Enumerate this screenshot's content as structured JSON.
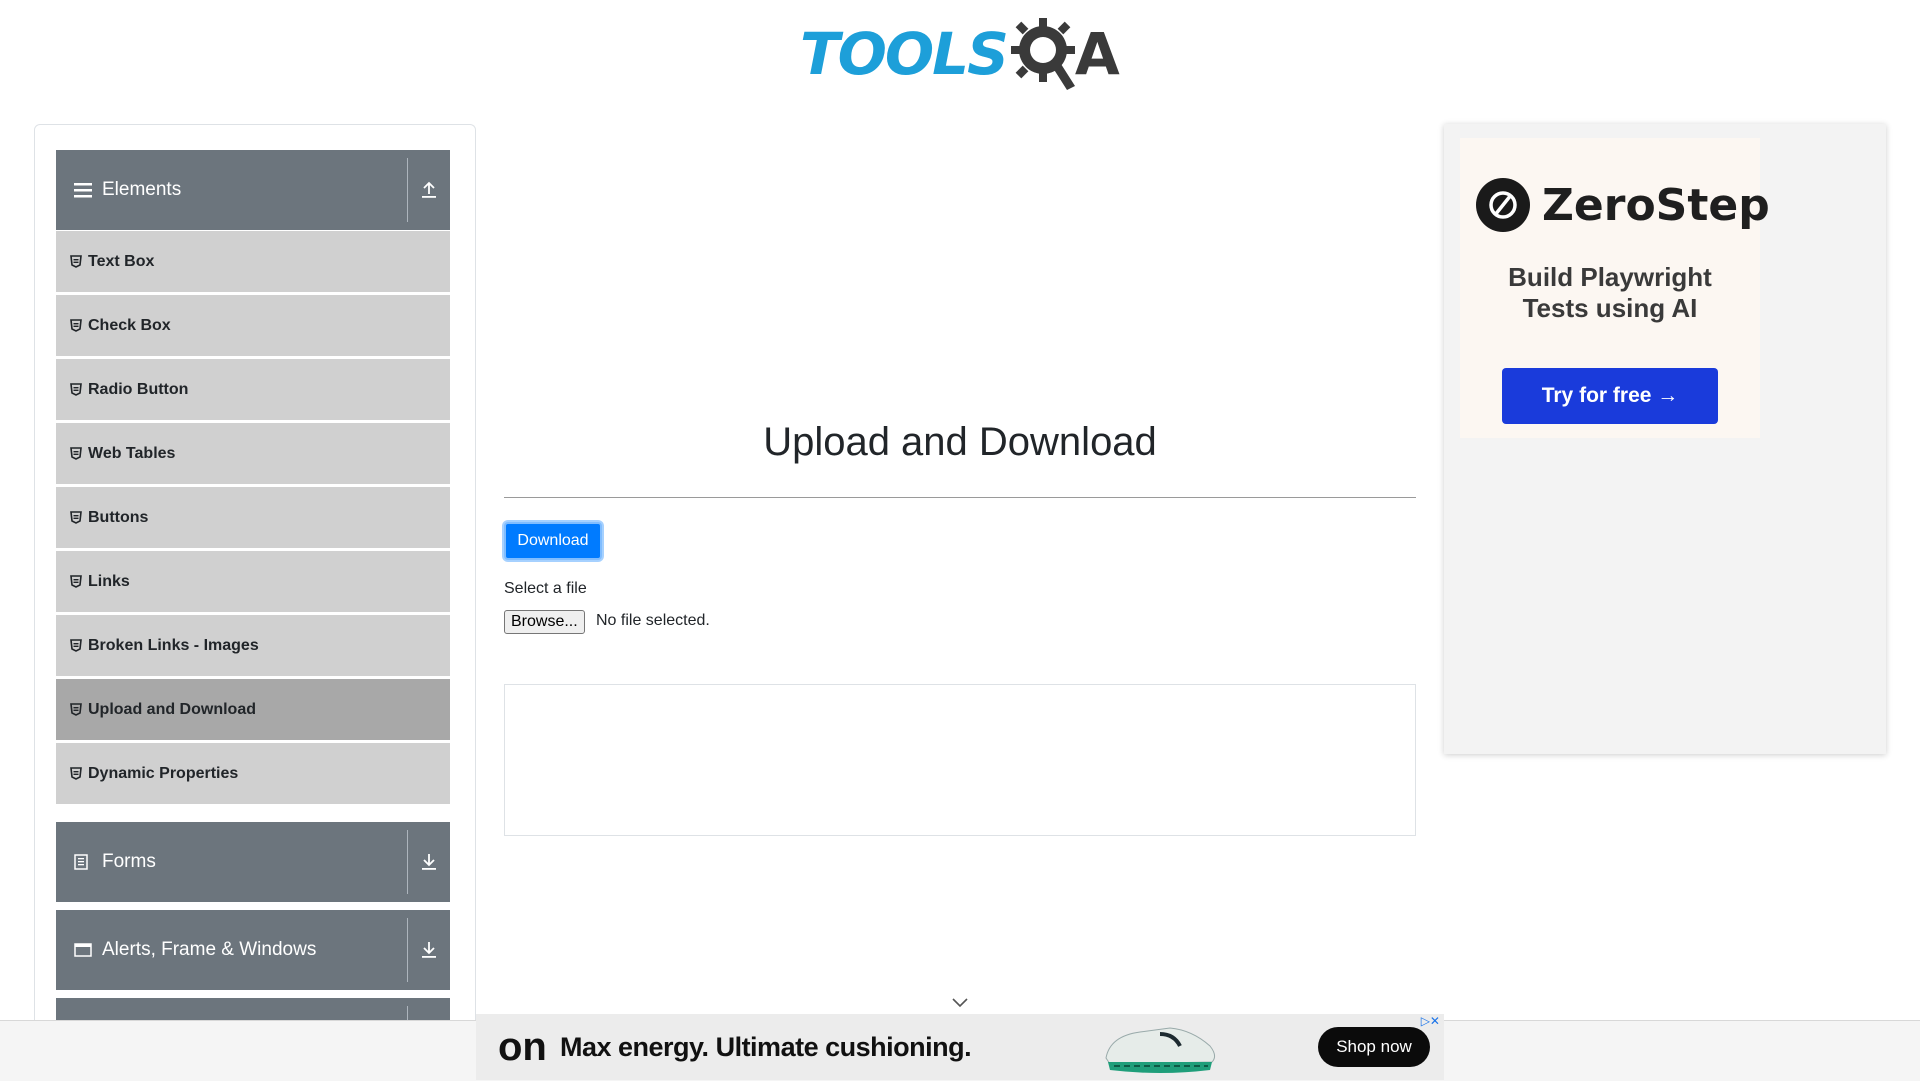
{
  "header": {
    "logo_text_left": "TOOLS",
    "logo_text_right": "A"
  },
  "sidebar": {
    "groups": [
      {
        "title": "Elements",
        "icon": "hamburger-icon",
        "toggle_icon": "arrow-up-icon"
      },
      {
        "title": "Forms",
        "icon": "form-icon",
        "toggle_icon": "arrow-down-icon"
      },
      {
        "title": "Alerts, Frame & Windows",
        "icon": "window-icon",
        "toggle_icon": "arrow-down-icon"
      }
    ],
    "items": [
      {
        "label": "Text Box"
      },
      {
        "label": "Check Box"
      },
      {
        "label": "Radio Button"
      },
      {
        "label": "Web Tables"
      },
      {
        "label": "Buttons"
      },
      {
        "label": "Links"
      },
      {
        "label": "Broken Links - Images"
      },
      {
        "label": "Upload and Download"
      },
      {
        "label": "Dynamic Properties"
      }
    ],
    "active_item": "Upload and Download"
  },
  "main": {
    "title": "Upload and Download",
    "download_label": "Download",
    "select_label": "Select a file",
    "browse_label": "Browse...",
    "no_file_text": "No file selected."
  },
  "side_ad": {
    "brand": "ZeroStep",
    "tagline_line1": "Build Playwright",
    "tagline_line2": "Tests using AI",
    "cta": "Try for free →"
  },
  "bottom_ad": {
    "logo": "on",
    "headline": "Max energy. Ultimate cushioning.",
    "cta": "Shop now"
  },
  "colors": {
    "accent": "#007bff",
    "sidebar_header": "#6c757d",
    "logo_blue": "#1d9fd9"
  }
}
